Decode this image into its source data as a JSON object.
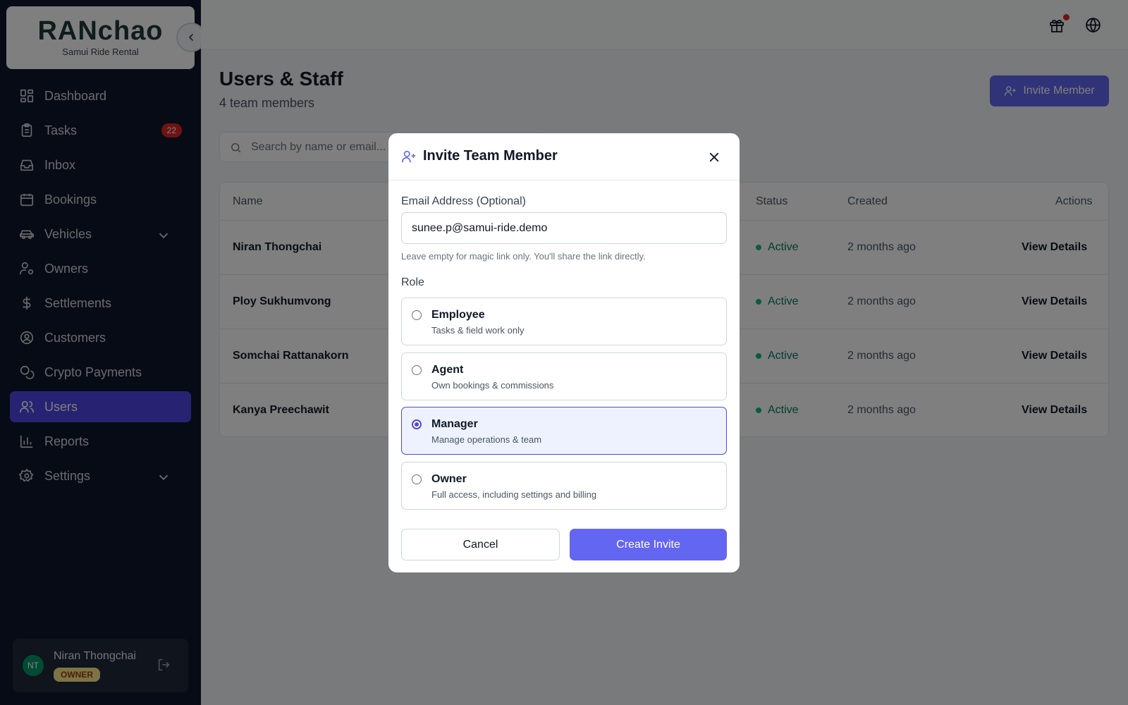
{
  "brand": {
    "logo_text": "RANchao",
    "subtitle": "Samui Ride Rental"
  },
  "sidebar": {
    "items": [
      {
        "label": "Dashboard",
        "icon": "dashboard-icon"
      },
      {
        "label": "Tasks",
        "icon": "clipboard-icon",
        "badge": "22"
      },
      {
        "label": "Inbox",
        "icon": "inbox-icon"
      },
      {
        "label": "Bookings",
        "icon": "calendar-icon"
      },
      {
        "label": "Vehicles",
        "icon": "car-icon",
        "expandable": true
      },
      {
        "label": "Owners",
        "icon": "user-cog-icon"
      },
      {
        "label": "Settlements",
        "icon": "dollar-icon"
      },
      {
        "label": "Customers",
        "icon": "user-circle-icon"
      },
      {
        "label": "Crypto Payments",
        "icon": "coins-icon"
      },
      {
        "label": "Users",
        "icon": "users-icon",
        "active": true
      },
      {
        "label": "Reports",
        "icon": "chart-icon"
      },
      {
        "label": "Settings",
        "icon": "gear-icon",
        "expandable": true
      }
    ],
    "user": {
      "initials": "NT",
      "name": "Niran Thongchai",
      "role": "OWNER"
    }
  },
  "header": {
    "title": "Users & Staff",
    "subtitle": "4 team members",
    "invite_label": "Invite Member"
  },
  "search": {
    "placeholder": "Search by name or email..."
  },
  "table": {
    "columns": {
      "name": "Name",
      "status": "Status",
      "created": "Created",
      "actions": "Actions"
    },
    "rows": [
      {
        "name": "Niran Thongchai",
        "status": "Active",
        "created": "2 months ago",
        "action": "View Details"
      },
      {
        "name": "Ploy Sukhumvong",
        "status": "Active",
        "created": "2 months ago",
        "action": "View Details"
      },
      {
        "name": "Somchai Rattanakorn",
        "status": "Active",
        "created": "2 months ago",
        "action": "View Details"
      },
      {
        "name": "Kanya Preechawit",
        "status": "Active",
        "created": "2 months ago",
        "action": "View Details"
      }
    ]
  },
  "modal": {
    "title": "Invite Team Member",
    "email_label": "Email Address (Optional)",
    "email_value": "sunee.p@samui-ride.demo",
    "email_hint": "Leave empty for magic link only. You'll share the link directly.",
    "role_label": "Role",
    "roles": [
      {
        "name": "Employee",
        "desc": "Tasks & field work only",
        "selected": false
      },
      {
        "name": "Agent",
        "desc": "Own bookings & commissions",
        "selected": false
      },
      {
        "name": "Manager",
        "desc": "Manage operations & team",
        "selected": true
      },
      {
        "name": "Owner",
        "desc": "Full access, including settings and billing",
        "selected": false
      }
    ],
    "cancel_label": "Cancel",
    "create_label": "Create Invite"
  },
  "colors": {
    "accent": "#6366f1",
    "sidebar_bg": "#0f172a",
    "status_active": "#047857",
    "badge": "#dc2626"
  }
}
